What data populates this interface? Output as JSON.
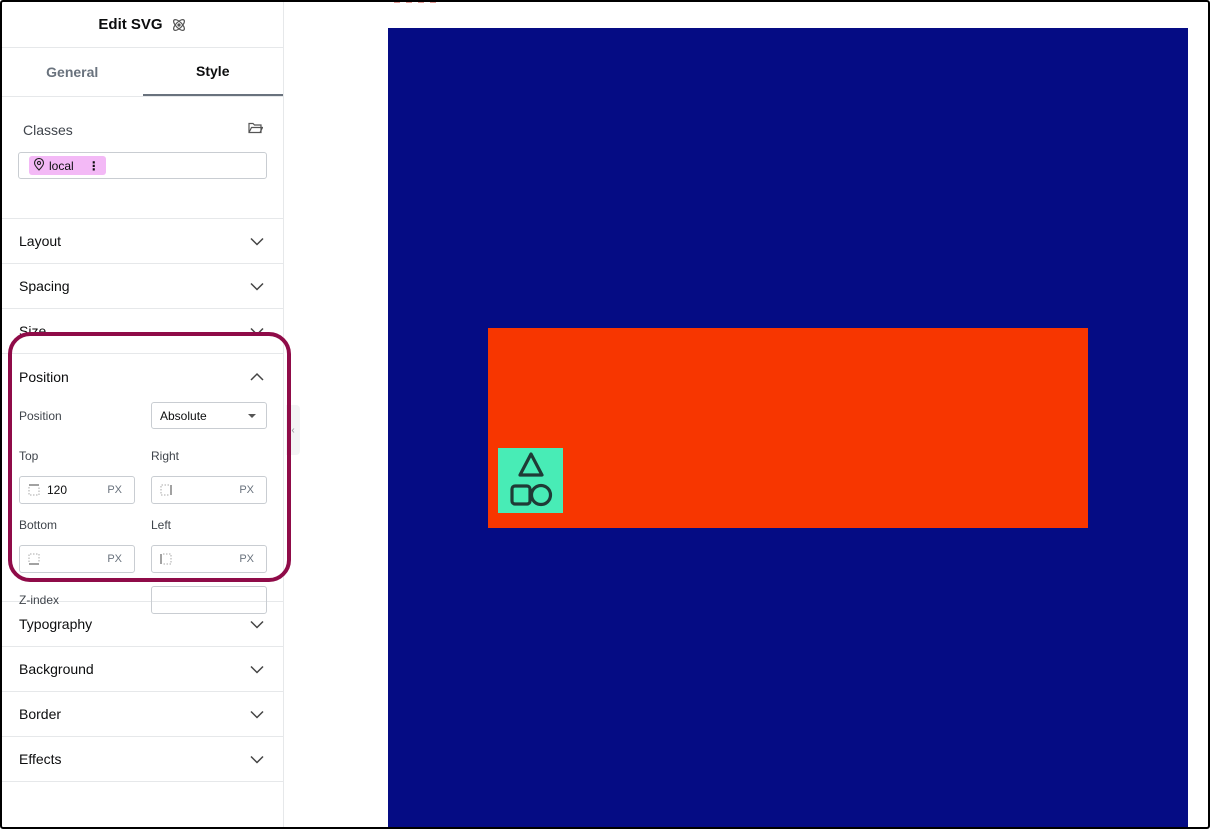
{
  "panel": {
    "title": "Edit SVG",
    "title_icon": "atom-icon"
  },
  "tabs": [
    {
      "label": "General",
      "active": false
    },
    {
      "label": "Style",
      "active": true
    }
  ],
  "classes": {
    "label": "Classes",
    "chip_label": "local",
    "chip_color": "#f3b9f6"
  },
  "sections_top": [
    {
      "title": "Layout"
    },
    {
      "title": "Spacing"
    },
    {
      "title": "Size"
    }
  ],
  "position": {
    "title": "Position",
    "position_label": "Position",
    "position_value": "Absolute",
    "top_label": "Top",
    "top_value": "120",
    "top_unit": "PX",
    "right_label": "Right",
    "right_value": "",
    "right_unit": "PX",
    "bottom_label": "Bottom",
    "bottom_value": "",
    "bottom_unit": "PX",
    "left_label": "Left",
    "left_value": "",
    "left_unit": "PX",
    "zindex_label": "Z-index",
    "zindex_value": ""
  },
  "sections_bottom": [
    {
      "title": "Typography"
    },
    {
      "title": "Background"
    },
    {
      "title": "Border"
    },
    {
      "title": "Effects"
    }
  ],
  "canvas": {
    "background_color": "#050c84",
    "box_color": "#f73600",
    "svg_bg_color": "#48ecb6",
    "highlight_color": "#8f0b48"
  }
}
